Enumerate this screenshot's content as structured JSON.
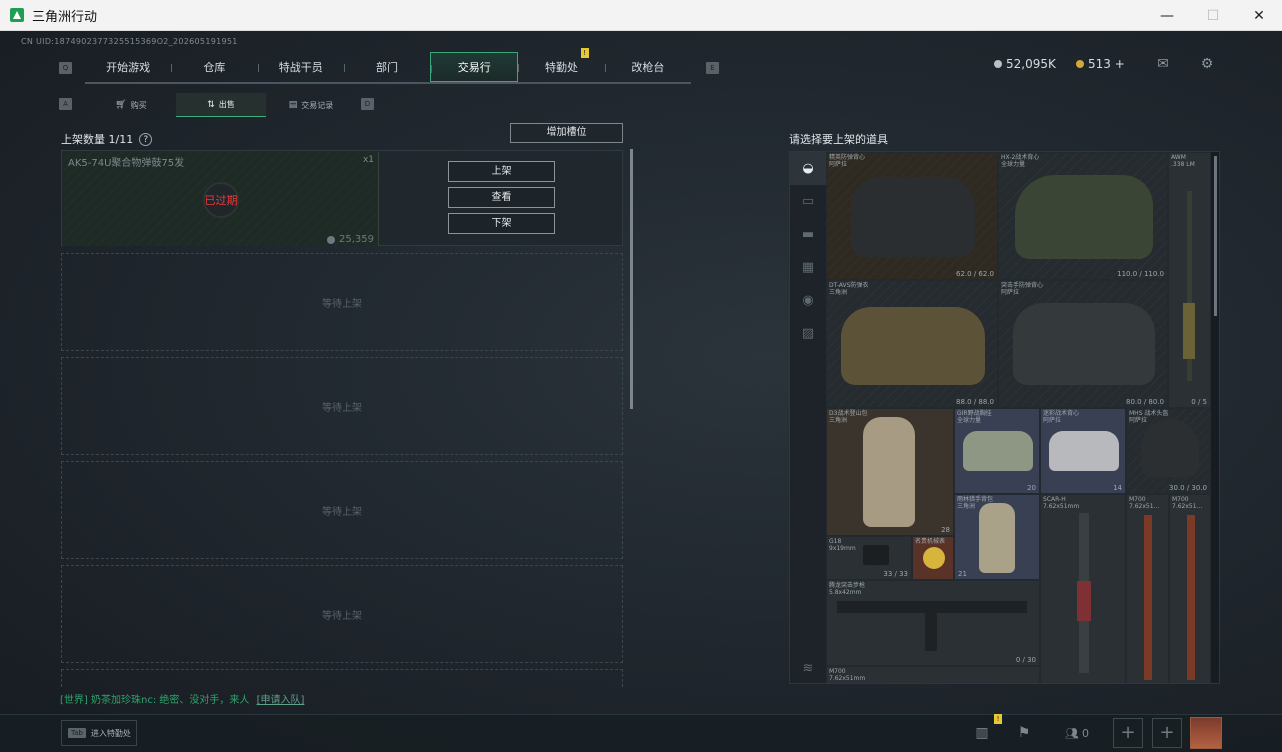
{
  "window": {
    "title": "三角洲行动",
    "minimize": "—",
    "maximize": "☐",
    "close": "✕"
  },
  "uid": "CN UID:1874902377325515369O2_202605191951",
  "nav": {
    "left_key": "Q",
    "right_key": "E",
    "tabs": [
      "开始游戏",
      "仓库",
      "特战干员",
      "部门",
      "交易行",
      "特勤处",
      "改枪台"
    ],
    "active_index": 4,
    "badge": "!"
  },
  "currency": {
    "silver": "52,095K",
    "gold": "513 +"
  },
  "subnav": {
    "left_key": "A",
    "right_key": "D",
    "tabs": [
      "购买",
      "出售",
      "交易记录"
    ],
    "active_index": 1
  },
  "shelf": {
    "count_label": "上架数量 1/11",
    "help": "?",
    "add_slot": "增加槽位",
    "listing": {
      "name": "AK5-74U聚合物弹鼓75发",
      "qty": "x1",
      "status": "已过期",
      "price": "25,359"
    },
    "buttons": [
      "上架",
      "查看",
      "下架"
    ],
    "empty_slot": "等待上架"
  },
  "chat": {
    "text": "[世界] 奶茶加珍珠nc: 绝密、没对手，来人",
    "join": "[申请入队]"
  },
  "bottom": {
    "tab_key": "Tab",
    "tab_label": "进入特勤处",
    "friends_count": "0"
  },
  "inventory": {
    "title": "请选择要上架的道具",
    "items": [
      {
        "name": "精英防弹背心\n阿萨拉",
        "foot": "62.0 / 62.0"
      },
      {
        "name": "HX-2战术背心\n全球力量",
        "foot": "110.0 / 110.0"
      },
      {
        "name": "AWM\n.338 LM",
        "foot": "0 / 5"
      },
      {
        "name": "DT-AVS防弹衣\n三角洲",
        "foot": "88.0 / 88.0"
      },
      {
        "name": "突击手防弹背心\n阿萨拉",
        "foot": "80.0 / 80.0"
      },
      {
        "name": "D3战术登山包\n三角洲",
        "foot": "28"
      },
      {
        "name": "GIR野战胸挂\n全球力量",
        "foot": "20"
      },
      {
        "name": "迷彩战术背心\n阿萨拉",
        "foot": "14"
      },
      {
        "name": "MHS 战术头盔\n阿萨拉",
        "foot": "30.0 / 30.0"
      },
      {
        "name": "G18\n9x19mm",
        "foot": "33 / 33"
      },
      {
        "name": "名贵机械表",
        "foot": ""
      },
      {
        "name": "雨林猎手背包\n三角洲",
        "foot": "21"
      },
      {
        "name": "SCAR-H\n7.62x51mm",
        "foot": ""
      },
      {
        "name": "M700\n7.62x51...",
        "foot": ""
      },
      {
        "name": "M700\n7.62x51...",
        "foot": ""
      },
      {
        "name": "腾龙突击步枪\n5.8x42mm",
        "foot": "0 / 30"
      },
      {
        "name": "M700\n7.62x51mm",
        "foot": ""
      }
    ]
  },
  "colors": {
    "accent": "#3aa77a",
    "expired": "#f0393a",
    "chat": "#2fa36b"
  }
}
